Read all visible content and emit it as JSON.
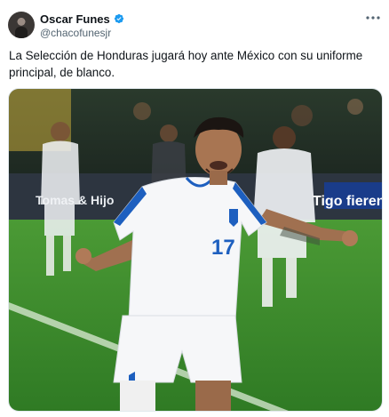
{
  "author": {
    "name": "Oscar Funes",
    "handle": "@chacofunesjr"
  },
  "tweet": {
    "text": "La Selección de Honduras jugará hoy ante México con su uniforme principal, de blanco."
  },
  "media": {
    "ad_board_left": "Tomas & Hijo",
    "ad_board_right": "Tigo fieren",
    "jersey_number": "17"
  },
  "colors": {
    "verified_badge": "#1d9bf0",
    "jersey_trim": "#1d5fbf",
    "pitch": "#3f8a2e"
  },
  "icons": {
    "verified": "verified-badge-icon",
    "more": "more-options-icon"
  }
}
